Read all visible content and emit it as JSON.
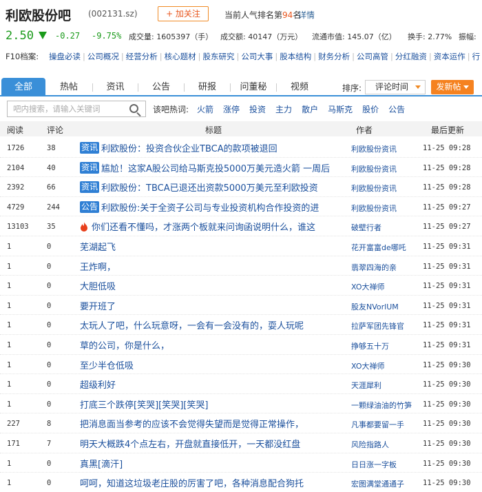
{
  "header": {
    "stock_name": "利欧股份吧",
    "stock_code": "(002131.sz)",
    "follow_label": "+ 加关注",
    "rank_prefix": "当前人气排名第",
    "rank_number": "94",
    "rank_suffix": "名",
    "rank_detail": "详情"
  },
  "quote": {
    "price": "2.50",
    "change": "-0.27",
    "change_pct": "-9.75%",
    "volume": "成交量: 1605397（手）",
    "turnover": "成交额: 40147（万元）",
    "market_cap": "流通市值: 145.07（亿）",
    "turnover_rate": "换手: 2.77%",
    "amplitude": "振幅:"
  },
  "f10": {
    "label": "F10档案:",
    "links": [
      "操盘必读",
      "公司概况",
      "经营分析",
      "核心题材",
      "股东研究",
      "公司大事",
      "股本结构",
      "财务分析",
      "公司高管",
      "分红融资",
      "资本运作",
      "行"
    ]
  },
  "tabs": [
    "全部",
    "热帖",
    "资讯",
    "公告",
    "研报",
    "问董秘",
    "视频"
  ],
  "sort": {
    "label": "排序:",
    "selected": "评论时间"
  },
  "post_button": "发新帖",
  "search": {
    "placeholder": "吧内搜索，请输入关键词"
  },
  "hot": {
    "label": "该吧热词:",
    "words": [
      "火箭",
      "涨停",
      "投资",
      "主力",
      "散户",
      "马斯克",
      "股价",
      "公告"
    ]
  },
  "columns": {
    "read": "阅读",
    "comment": "评论",
    "title": "标题",
    "author": "作者",
    "updated": "最后更新"
  },
  "rows": [
    {
      "read": "1726",
      "comment": "38",
      "tag": "资讯",
      "title": "利欧股份：投资合伙企业TBCA的款项被退回",
      "author": "利欧股份资讯",
      "time": "11-25 09:28"
    },
    {
      "read": "2104",
      "comment": "40",
      "tag": "资讯",
      "title": "尴尬！这家A股公司给马斯克投5000万美元造火箭 一周后",
      "author": "利欧股份资讯",
      "time": "11-25 09:28"
    },
    {
      "read": "2392",
      "comment": "66",
      "tag": "资讯",
      "title": "利欧股份：TBCA已退还出资款5000万美元至利欧投资",
      "author": "利欧股份资讯",
      "time": "11-25 09:28"
    },
    {
      "read": "4729",
      "comment": "244",
      "tag": "公告",
      "title": "利欧股份:关于全资子公司与专业投资机构合作投资的进",
      "author": "利欧股份资讯",
      "time": "11-25 09:27"
    },
    {
      "read": "13103",
      "comment": "35",
      "tag": "",
      "hot": true,
      "title": "你们还看不懂吗，才涨两个板就来问询函说明什么，谁这",
      "author": "破壁行者",
      "time": "11-25 09:27"
    },
    {
      "read": "1",
      "comment": "0",
      "tag": "",
      "title": "芜湖起飞",
      "author": "花开富富de哪吒",
      "time": "11-25 09:31"
    },
    {
      "read": "1",
      "comment": "0",
      "tag": "",
      "title": "王炸啊，",
      "author": "翡翠四海的亲",
      "time": "11-25 09:31"
    },
    {
      "read": "1",
      "comment": "0",
      "tag": "",
      "title": "大胆低吸",
      "author": "XO大禅师",
      "time": "11-25 09:31"
    },
    {
      "read": "1",
      "comment": "0",
      "tag": "",
      "title": "要开班了",
      "author": "股友NVorlUM",
      "time": "11-25 09:31"
    },
    {
      "read": "1",
      "comment": "0",
      "tag": "",
      "title": "太玩人了吧，什么玩意呀，一会有一会没有的，耍人玩呢",
      "author": "拉萨军团先锋官",
      "time": "11-25 09:31"
    },
    {
      "read": "1",
      "comment": "0",
      "tag": "",
      "title": "草的公司，你是什么，",
      "author": "挣够五十万",
      "time": "11-25 09:31"
    },
    {
      "read": "1",
      "comment": "0",
      "tag": "",
      "title": "至少半仓低吸",
      "author": "XO大禅师",
      "time": "11-25 09:30"
    },
    {
      "read": "1",
      "comment": "0",
      "tag": "",
      "title": "超级利好",
      "author": "天涯犀利",
      "time": "11-25 09:30"
    },
    {
      "read": "1",
      "comment": "0",
      "tag": "",
      "title": "打底三个跌停[笑哭][笑哭][笑哭]",
      "author": "一颗绿油油的竹笋",
      "time": "11-25 09:30"
    },
    {
      "read": "227",
      "comment": "8",
      "tag": "",
      "title": "把消息面当参考的应该不会觉得失望而是觉得正常操作，",
      "author": "凡事都要留一手",
      "time": "11-25 09:30"
    },
    {
      "read": "171",
      "comment": "7",
      "tag": "",
      "title": "明天大概跌4个点左右，开盘就直接低开，一天都没红盘",
      "author": "风险指路人",
      "time": "11-25 09:30"
    },
    {
      "read": "1",
      "comment": "0",
      "tag": "",
      "title": "真黑[滴汗]",
      "author": "日日涨一字板",
      "time": "11-25 09:30"
    },
    {
      "read": "1",
      "comment": "0",
      "tag": "",
      "title": "呵呵，知道这垃圾老庄股的厉害了吧，各种消息配合狗托",
      "author": "宏图满堂通通子",
      "time": "11-25 09:30"
    }
  ]
}
